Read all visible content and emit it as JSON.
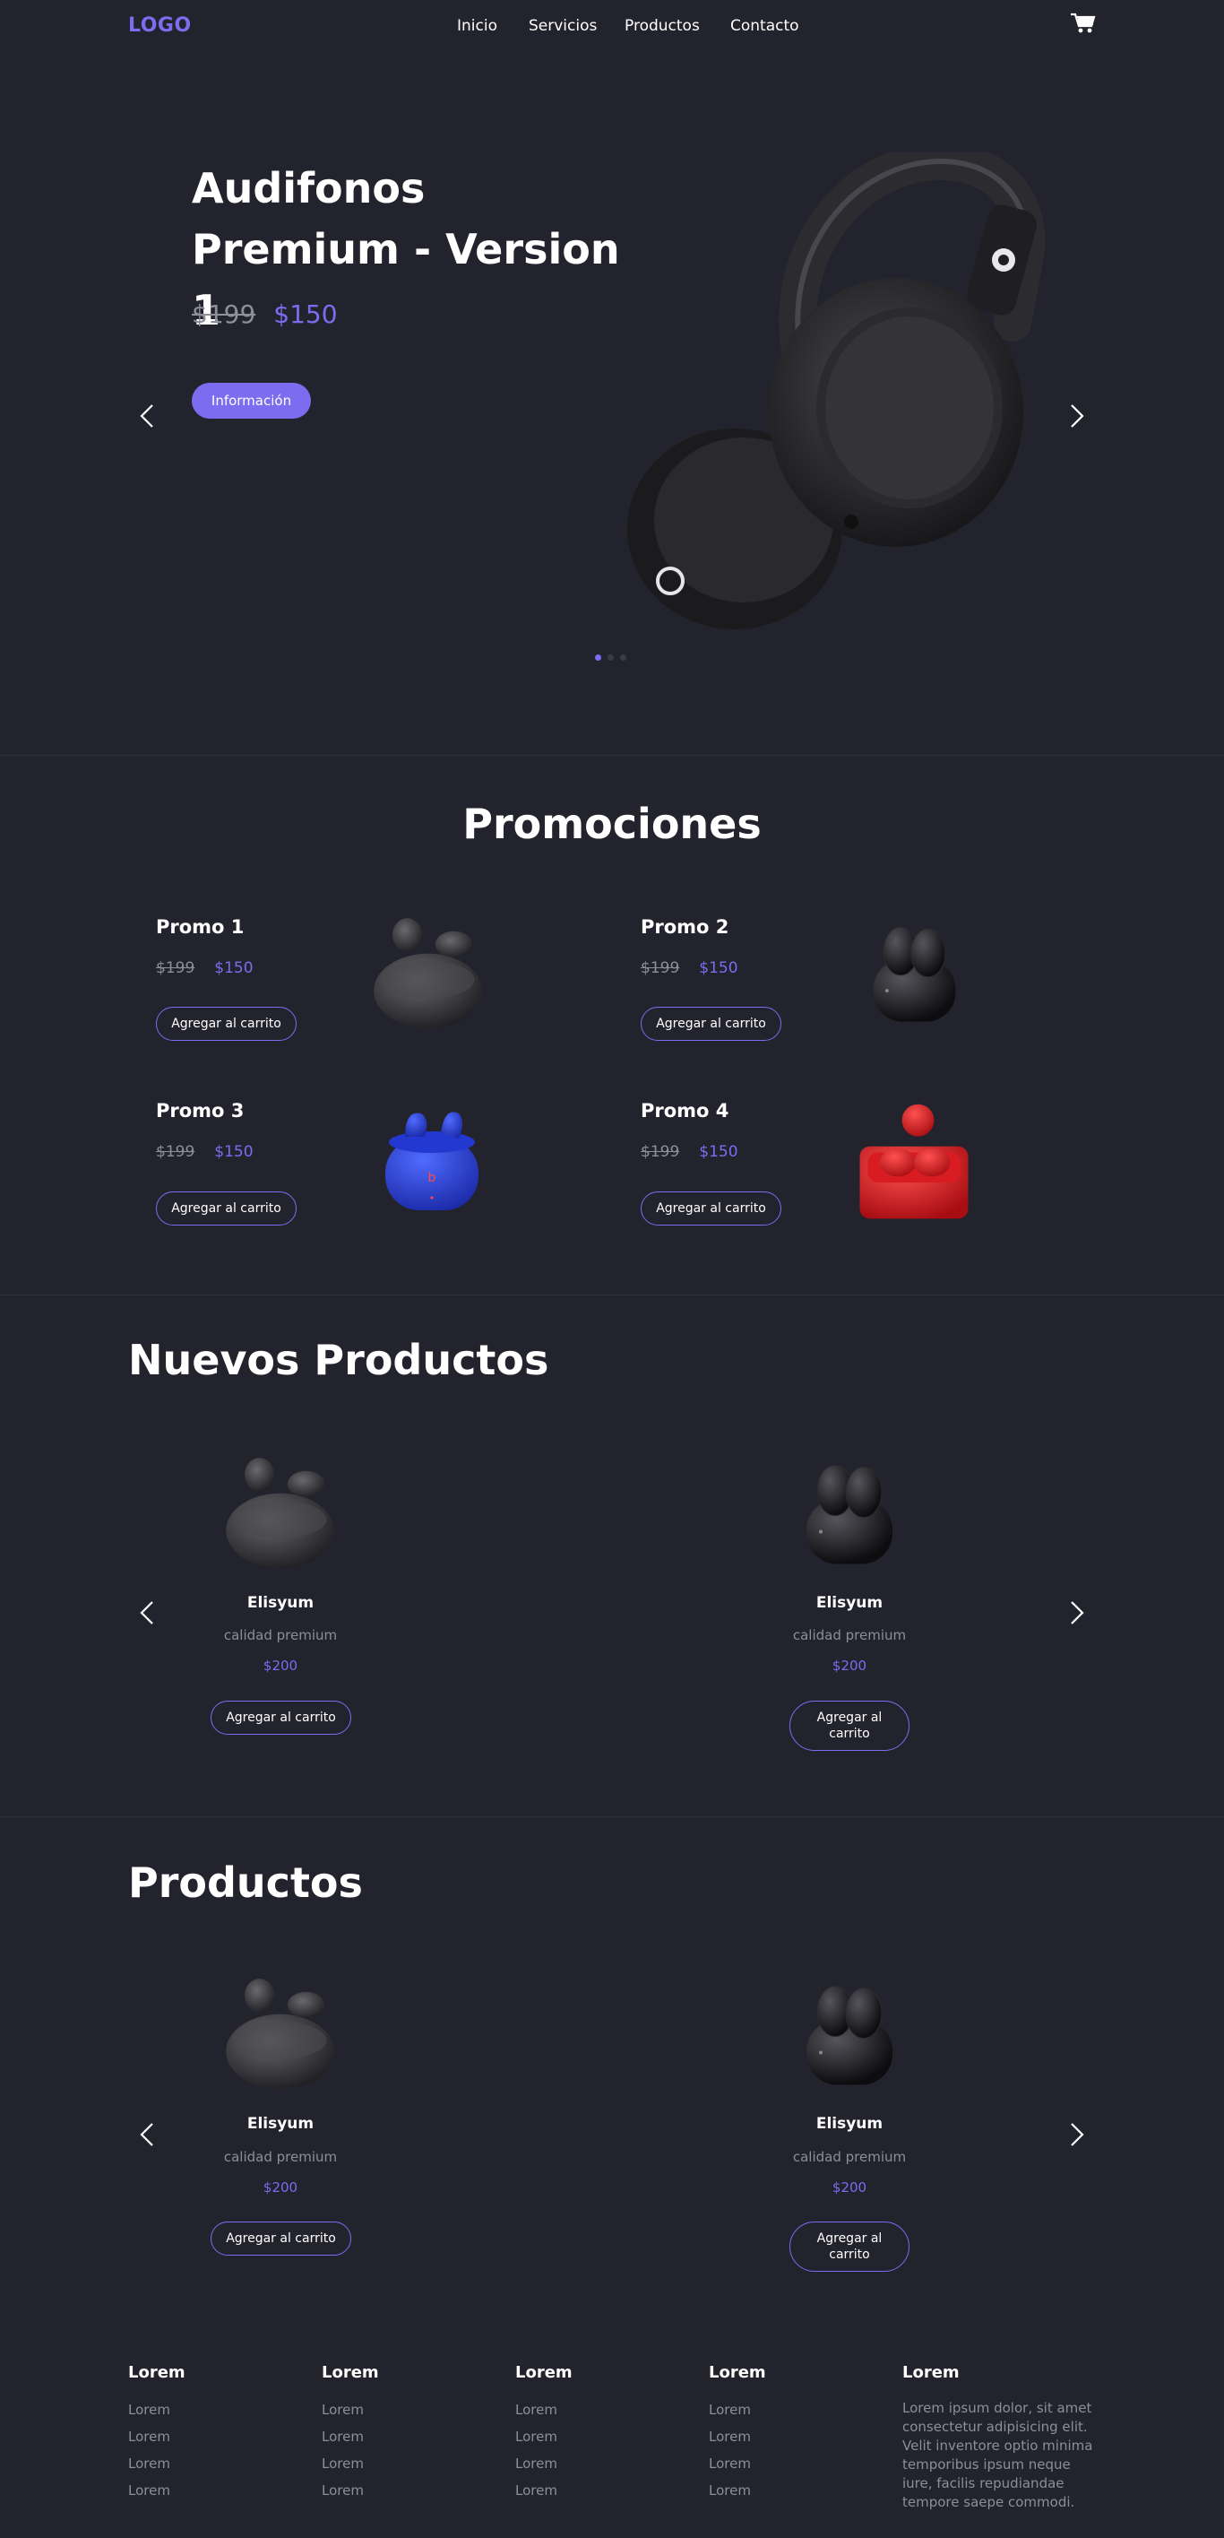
{
  "nav": {
    "logo": "LOGO",
    "links": [
      "Inicio",
      "Servicios",
      "Productos",
      "Contacto"
    ],
    "cart_icon": "cart-icon"
  },
  "hero": {
    "title": "Audifonos Premium - Version 1",
    "price_old": "$199",
    "price_new": "$150",
    "button_label": "Información",
    "slides": 3,
    "active_slide": 1
  },
  "promos": {
    "title": "Promociones",
    "items": [
      {
        "name": "Promo 1",
        "price_old": "$199",
        "price_new": "$150",
        "button": "Agregar al carrito",
        "image": "gray-earbuds"
      },
      {
        "name": "Promo 2",
        "price_old": "$199",
        "price_new": "$150",
        "button": "Agregar al carrito",
        "image": "black-earbuds"
      },
      {
        "name": "Promo 3",
        "price_old": "$199",
        "price_new": "$150",
        "button": "Agregar al carrito",
        "image": "blue-earbuds"
      },
      {
        "name": "Promo 4",
        "price_old": "$199",
        "price_new": "$150",
        "button": "Agregar al carrito",
        "image": "red-earbuds"
      }
    ]
  },
  "new_products": {
    "title": "Nuevos Productos",
    "items": [
      {
        "name": "Elisyum",
        "subtitle": "calidad premium",
        "price": "$200",
        "button": "Agregar al carrito",
        "image": "gray-earbuds"
      },
      {
        "name": "Elisyum",
        "subtitle": "calidad premium",
        "price": "$200",
        "button": "Agregar al carrito",
        "image": "black-earbuds"
      }
    ]
  },
  "products": {
    "title": "Productos",
    "items": [
      {
        "name": "Elisyum",
        "subtitle": "calidad premium",
        "price": "$200",
        "button": "Agregar al carrito",
        "image": "gray-earbuds"
      },
      {
        "name": "Elisyum",
        "subtitle": "calidad premium",
        "price": "$200",
        "button": "Agregar al carrito",
        "image": "black-earbuds"
      }
    ]
  },
  "footer": {
    "columns": [
      {
        "title": "Lorem",
        "links": [
          "Lorem",
          "Lorem",
          "Lorem",
          "Lorem"
        ]
      },
      {
        "title": "Lorem",
        "links": [
          "Lorem",
          "Lorem",
          "Lorem",
          "Lorem"
        ]
      },
      {
        "title": "Lorem",
        "links": [
          "Lorem",
          "Lorem",
          "Lorem",
          "Lorem"
        ]
      },
      {
        "title": "Lorem",
        "links": [
          "Lorem",
          "Lorem",
          "Lorem",
          "Lorem"
        ]
      }
    ],
    "about": {
      "title": "Lorem",
      "text": "Lorem ipsum dolor, sit amet consectetur adipisicing elit. Velit inventore optio minima temporibus ipsum neque iure, facilis repudiandae tempore saepe commodi."
    }
  },
  "colors": {
    "background": "#23232d",
    "accent": "#7b6cf0",
    "muted": "#8e8e98"
  }
}
